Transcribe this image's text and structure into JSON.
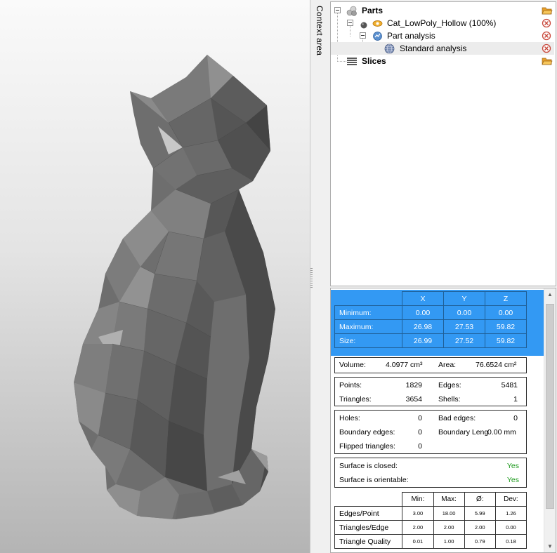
{
  "viewport": {
    "context_area_label": "Context area"
  },
  "tree": {
    "parts": {
      "label": "Parts"
    },
    "part": {
      "label": "Cat_LowPoly_Hollow (100%)"
    },
    "analysis": {
      "label": "Part analysis"
    },
    "standard": {
      "label": "Standard analysis"
    },
    "slices": {
      "label": "Slices"
    }
  },
  "bbox": {
    "headers": [
      "X",
      "Y",
      "Z"
    ],
    "rows": [
      {
        "label": "Minimum:",
        "x": "0.00",
        "y": "0.00",
        "z": "0.00"
      },
      {
        "label": "Maximum:",
        "x": "26.98",
        "y": "27.53",
        "z": "59.82"
      },
      {
        "label": "Size:",
        "x": "26.99",
        "y": "27.52",
        "z": "59.82"
      }
    ]
  },
  "volume": {
    "label": "Volume:",
    "value": "4.0977 cm³"
  },
  "area": {
    "label": "Area:",
    "value": "76.6524 cm²"
  },
  "counts": {
    "points_label": "Points:",
    "points": "1829",
    "edges_label": "Edges:",
    "edges": "5481",
    "triangles_label": "Triangles:",
    "triangles": "3654",
    "shells_label": "Shells:",
    "shells": "1"
  },
  "errors": {
    "holes_label": "Holes:",
    "holes": "0",
    "bad_edges_label": "Bad edges:",
    "bad_edges": "0",
    "boundary_edges_label": "Boundary edges:",
    "boundary_edges": "0",
    "boundary_length_label": "Boundary Leng",
    "boundary_length": "0.00 mm",
    "flipped_label": "Flipped triangles:",
    "flipped": "0"
  },
  "surface": {
    "closed_label": "Surface is closed:",
    "closed": "Yes",
    "orientable_label": "Surface is orientable:",
    "orientable": "Yes"
  },
  "stats": {
    "headers": [
      "Min:",
      "Max:",
      "Ø:",
      "Dev:"
    ],
    "rows": [
      {
        "label": "Edges/Point",
        "min": "3.00",
        "max": "18.00",
        "avg": "5.99",
        "dev": "1.26"
      },
      {
        "label": "Triangles/Edge",
        "min": "2.00",
        "max": "2.00",
        "avg": "2.00",
        "dev": "0.00"
      },
      {
        "label": "Triangle Quality",
        "min": "0.01",
        "max": "1.00",
        "avg": "0.79",
        "dev": "0.18"
      }
    ]
  },
  "colors": {
    "selection_blue": "#3399f3",
    "yes_green": "#1e9a1e",
    "model_gray": "#6e6e6e"
  }
}
